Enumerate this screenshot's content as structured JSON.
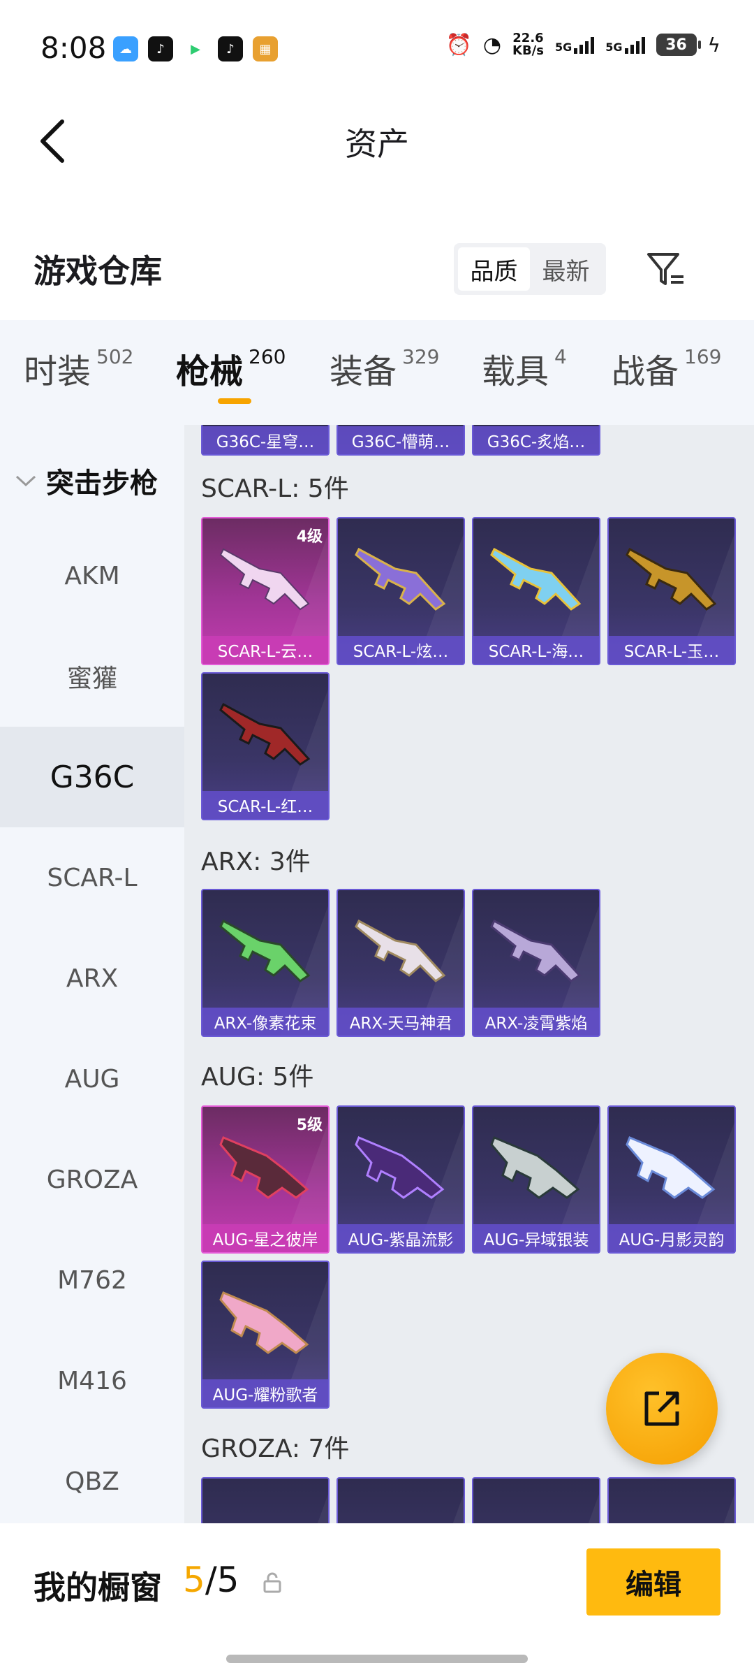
{
  "status_bar": {
    "time": "8:08",
    "speed_value": "22.6",
    "speed_unit": "KB/s",
    "signal1": "5G",
    "signal2": "5G",
    "battery": "36"
  },
  "header": {
    "title": "资产"
  },
  "section": {
    "title": "游戏仓库",
    "sort_options": [
      "品质",
      "最新"
    ],
    "sort_selected": "品质"
  },
  "tabs": [
    {
      "label": "时装",
      "count": "502"
    },
    {
      "label": "枪械",
      "count": "260",
      "active": true
    },
    {
      "label": "装备",
      "count": "329"
    },
    {
      "label": "载具",
      "count": "4"
    },
    {
      "label": "战备",
      "count": "169"
    }
  ],
  "sidebar": {
    "group": "突击步枪",
    "items": [
      "AKM",
      "蜜獾",
      "G36C",
      "SCAR-L",
      "ARX",
      "AUG",
      "GROZA",
      "M762",
      "M416",
      "QBZ"
    ],
    "active": "G36C"
  },
  "content": {
    "top_partial": [
      "G36C-星穹…",
      "G36C-懵萌…",
      "G36C-炙焰…"
    ],
    "groups": [
      {
        "header": "SCAR-L: 5件",
        "items": [
          {
            "name": "SCAR-L-云…",
            "level": "4级",
            "rarity": "gold"
          },
          {
            "name": "SCAR-L-炫…"
          },
          {
            "name": "SCAR-L-海…"
          },
          {
            "name": "SCAR-L-玉…"
          },
          {
            "name": "SCAR-L-红…"
          }
        ]
      },
      {
        "header": "ARX: 3件",
        "items": [
          {
            "name": "ARX-像素花束"
          },
          {
            "name": "ARX-天马神君"
          },
          {
            "name": "ARX-凌霄紫焰"
          }
        ]
      },
      {
        "header": "AUG: 5件",
        "items": [
          {
            "name": "AUG-星之彼岸",
            "level": "5级",
            "rarity": "gold"
          },
          {
            "name": "AUG-紫晶流影"
          },
          {
            "name": "AUG-异域银装"
          },
          {
            "name": "AUG-月影灵韵"
          },
          {
            "name": "AUG-耀粉歌者"
          }
        ]
      },
      {
        "header": "GROZA: 7件",
        "items": []
      }
    ]
  },
  "bottom": {
    "my_window_label": "我的橱窗",
    "count_current": "5",
    "count_sep": "/",
    "count_total": "5",
    "edit_label": "编辑"
  },
  "colors": {
    "accent": "#f7a400",
    "card_purple": "#3a3566",
    "card_gold": "#c43db1"
  }
}
